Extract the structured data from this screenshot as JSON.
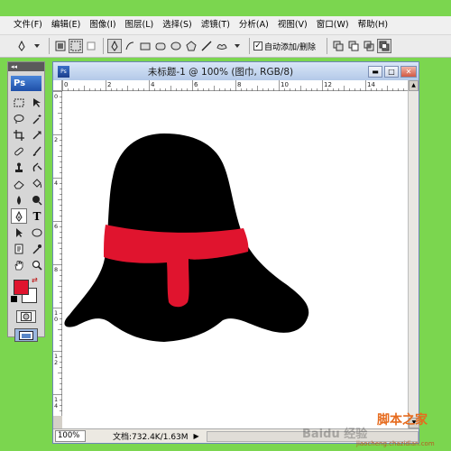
{
  "menubar": {
    "items": [
      "文件(F)",
      "编辑(E)",
      "图像(I)",
      "图层(L)",
      "选择(S)",
      "滤镜(T)",
      "分析(A)",
      "视图(V)",
      "窗口(W)",
      "帮助(H)"
    ]
  },
  "options_bar": {
    "auto_add_delete_label": "自动添加/删除",
    "auto_add_delete_checked": true,
    "check_mark": "✓"
  },
  "toolbox": {
    "header_glyph": "◂◂",
    "logo": "Ps",
    "foreground_color": "#e0142e",
    "background_color": "#ffffff",
    "type_tool_glyph": "T"
  },
  "document": {
    "title": "未标题-1 @ 100% (图巾, RGB/8)",
    "icon_label": "Ps",
    "minimize_glyph": "▬",
    "maximize_glyph": "□",
    "close_glyph": "✕",
    "zoom": "100%",
    "doc_size": "文档:732.4K/1.63M",
    "status_arrow": "▶"
  },
  "ruler": {
    "h_labels": [
      "0",
      "2",
      "4",
      "6",
      "8",
      "10",
      "12",
      "14"
    ],
    "v_labels": [
      "0",
      "2",
      "4",
      "6",
      "8",
      "1\n0",
      "1\n2",
      "1\n4"
    ]
  },
  "artwork": {
    "hat_color": "#000000",
    "band_color": "#e0142e"
  },
  "watermark": {
    "site_cn": "脚本之家",
    "site_url": "jiaocheng.chazidian.com",
    "baidu": "Baidu 经验"
  }
}
